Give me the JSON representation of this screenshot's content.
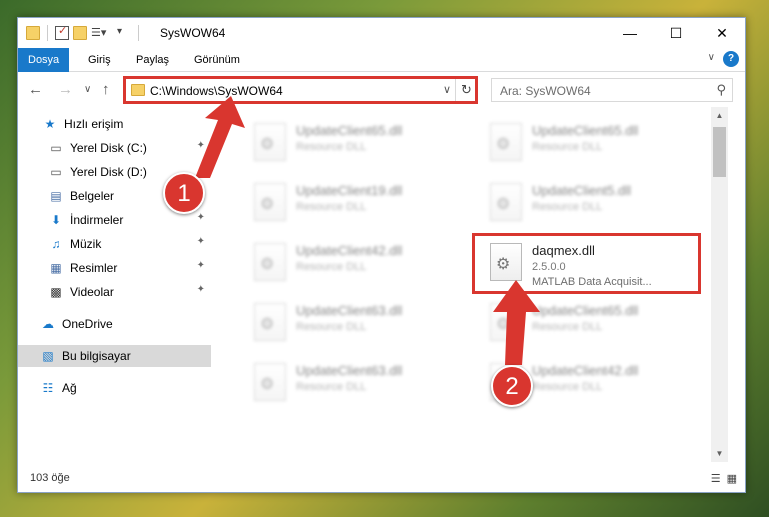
{
  "window": {
    "title": "SysWOW64"
  },
  "ribbon": {
    "tabs": [
      "Dosya",
      "Giriş",
      "Paylaş",
      "Görünüm"
    ]
  },
  "address": {
    "path": "C:\\Windows\\SysWOW64"
  },
  "search": {
    "placeholder": "Ara: SysWOW64"
  },
  "nav": {
    "items": [
      {
        "label": "Hızlı erişim",
        "icon": "star-icon"
      },
      {
        "label": "Yerel Disk (C:)",
        "icon": "drive-icon"
      },
      {
        "label": "Yerel Disk (D:)",
        "icon": "drive-icon"
      },
      {
        "label": "Belgeler",
        "icon": "documents-icon"
      },
      {
        "label": "İndirmeler",
        "icon": "download-icon"
      },
      {
        "label": "Müzik",
        "icon": "music-icon"
      },
      {
        "label": "Resimler",
        "icon": "pictures-icon"
      },
      {
        "label": "Videolar",
        "icon": "videos-icon"
      },
      {
        "label": "OneDrive",
        "icon": "cloud-icon"
      },
      {
        "label": "Bu bilgisayar",
        "icon": "computer-icon"
      },
      {
        "label": "Ağ",
        "icon": "network-icon"
      }
    ]
  },
  "files": {
    "blurred": [
      {
        "name": "UpdateClient65.dll",
        "desc": "Resource DLL"
      },
      {
        "name": "UpdateClient65.dll",
        "desc": "Resource DLL"
      },
      {
        "name": "UpdateClient19.dll",
        "desc": "Resource DLL"
      },
      {
        "name": "UpdateClient5.dll",
        "desc": "Resource DLL"
      },
      {
        "name": "UpdateClient42.dll",
        "desc": "Resource DLL"
      },
      {
        "name": "UpdateClient63.dll",
        "desc": "Resource DLL"
      },
      {
        "name": "UpdateClient65.dll",
        "desc": "Resource DLL"
      },
      {
        "name": "UpdateClient63.dll",
        "desc": "Resource DLL"
      },
      {
        "name": "UpdateClient42.dll",
        "desc": "Resource DLL"
      }
    ],
    "highlighted": {
      "name": "daqmex.dll",
      "version": "2.5.0.0",
      "desc": "MATLAB Data Acquisit..."
    }
  },
  "status": {
    "count": "103 öğe"
  },
  "annotations": {
    "step1": "1",
    "step2": "2"
  },
  "colors": {
    "accent": "#1979ca",
    "annotation": "#d9362f"
  }
}
